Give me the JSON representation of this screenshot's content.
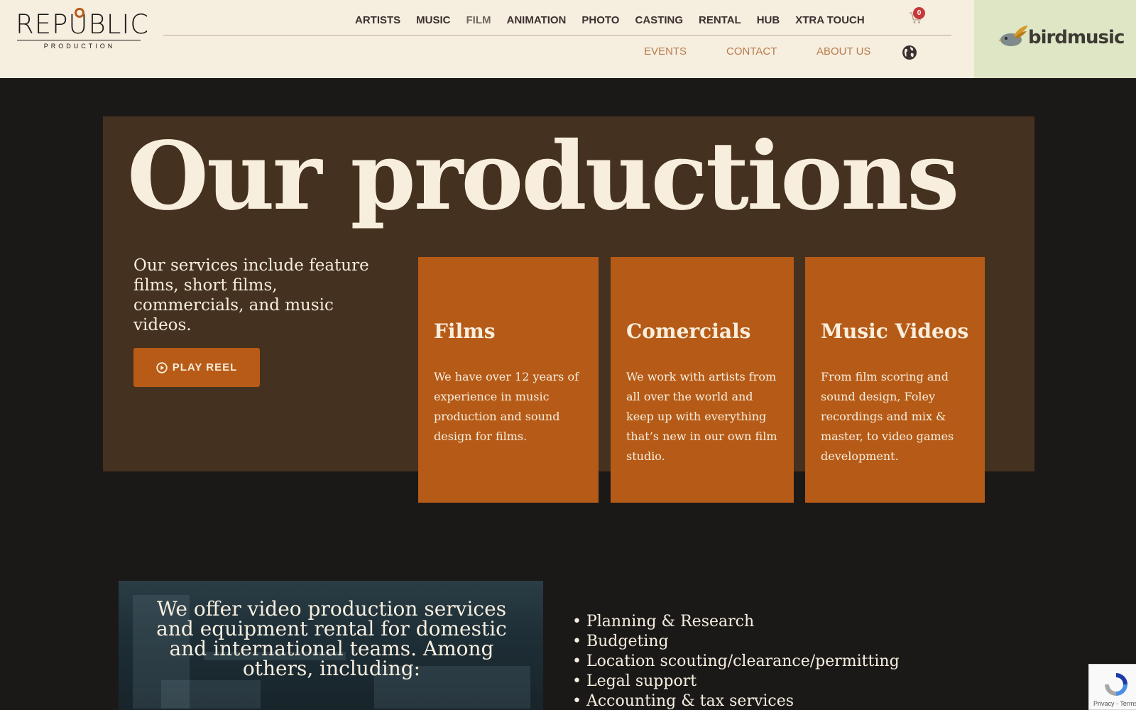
{
  "header": {
    "logo": {
      "wordmark": "REPUBLIC",
      "subtitle": "PRODUCTION"
    },
    "nav_main": [
      "ARTISTS",
      "MUSIC",
      "FILM",
      "ANIMATION",
      "PHOTO",
      "CASTING",
      "RENTAL",
      "HUB",
      "XTRA TOUCH"
    ],
    "active_nav": "FILM",
    "cart_count": "0",
    "nav_sub": [
      "EVENTS",
      "CONTACT",
      "ABOUT US"
    ],
    "partner_logo_text": "birdmusic"
  },
  "hero": {
    "title": "Our productions",
    "description": "Our services include feature films, short films, commercials, and music videos.",
    "play_button": "PLAY REEL"
  },
  "cards": [
    {
      "title": "Films",
      "text": "We have over 12 years of experience in music production and sound design for films."
    },
    {
      "title": "Comercials",
      "text": "We work with artists from all over the world and keep up with everything that’s new in our own film studio."
    },
    {
      "title": "Music Videos",
      "text": "From film scoring and sound design,  Foley recordings and mix & master, to video games development."
    }
  ],
  "offer": {
    "text": "We offer video production services and equipment rental for domestic and international teams. Among others, including:",
    "services": [
      "• Planning & Research",
      "• Budgeting",
      "• Location scouting/clearance/permitting",
      "• Legal support",
      "• Accounting & tax services"
    ]
  },
  "recaptcha": {
    "links": "Privacy - Terms"
  },
  "colors": {
    "header_bg": "#f6eedf",
    "page_bg": "#1b1918",
    "hero_bg": "#45311f",
    "accent": "#b65b17",
    "cream_text": "#f8eedd",
    "partner_bg": "#dfe6c6"
  }
}
